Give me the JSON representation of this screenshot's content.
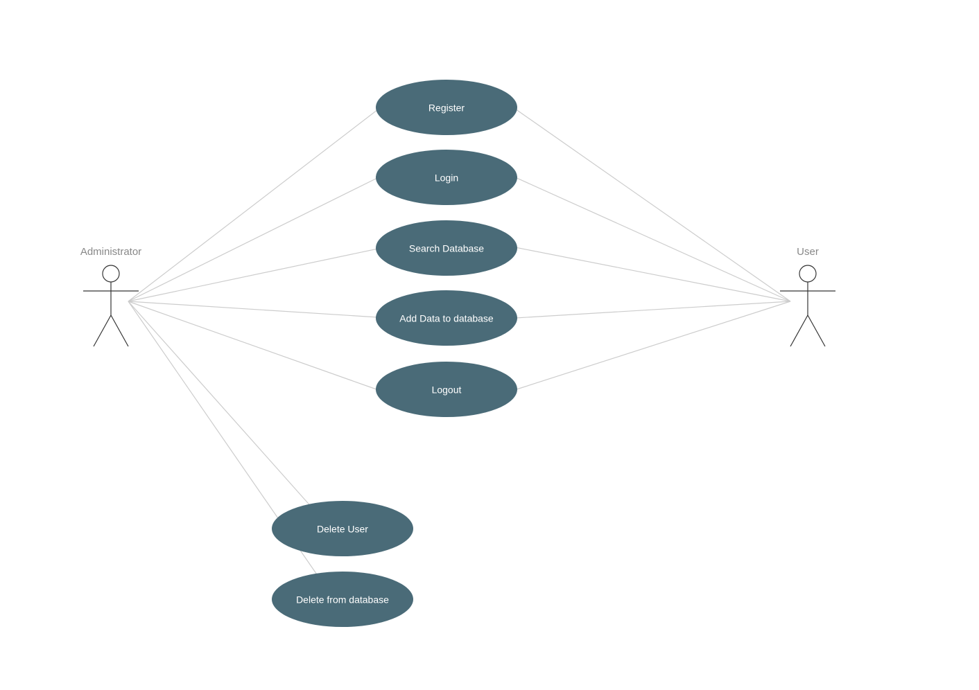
{
  "actors": {
    "administrator": {
      "label": "Administrator"
    },
    "user": {
      "label": "User"
    }
  },
  "usecases": {
    "register": {
      "label": "Register"
    },
    "login": {
      "label": "Login"
    },
    "search_database": {
      "label": "Search Database"
    },
    "add_data": {
      "label": "Add Data to database"
    },
    "logout": {
      "label": "Logout"
    },
    "delete_user": {
      "label": "Delete User"
    },
    "delete_from_db": {
      "label": "Delete  from database"
    }
  }
}
